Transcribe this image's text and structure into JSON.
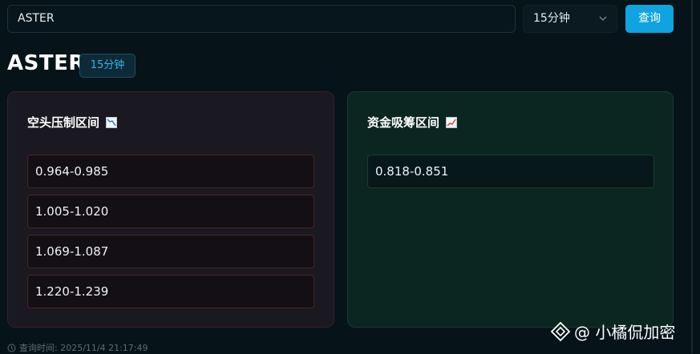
{
  "search": {
    "value": "ASTER"
  },
  "interval_select": {
    "value": "15分钟"
  },
  "query_button": {
    "label": "查询"
  },
  "header": {
    "title": "ASTER",
    "badge": "15分钟"
  },
  "short_card": {
    "title": "空头压制区间",
    "icon": "chart-decreasing-icon",
    "ranges": [
      "0.964-0.985",
      "1.005-1.020",
      "1.069-1.087",
      "1.220-1.239"
    ]
  },
  "long_card": {
    "title": "资金吸筹区间",
    "icon": "chart-increasing-icon",
    "ranges": [
      "0.818-0.851"
    ]
  },
  "footer": {
    "query_time": "查询时间: 2025/11/4 21:17:49"
  },
  "watermark": {
    "text": "@ 小橘侃加密"
  },
  "colors": {
    "accent": "#0fa3e0",
    "short_bg": "#1a1820",
    "long_bg": "#0b2520"
  }
}
